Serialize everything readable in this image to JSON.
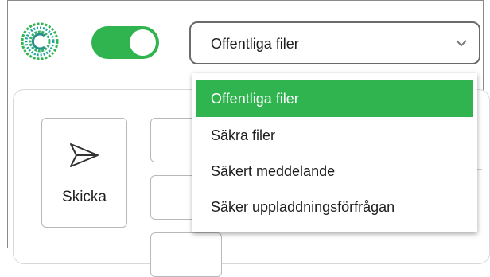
{
  "header": {
    "logo_icon": "logo-icon",
    "toggle_on": true,
    "accent_color": "#2fb44f"
  },
  "file_type_select": {
    "value": "Offentliga filer",
    "options": [
      "Offentliga filer",
      "Säkra filer",
      "Säkert meddelande",
      "Säker uppladdningsförfrågan"
    ],
    "selected_index": 0
  },
  "send_button": {
    "label": "Skicka",
    "icon": "send-icon"
  }
}
